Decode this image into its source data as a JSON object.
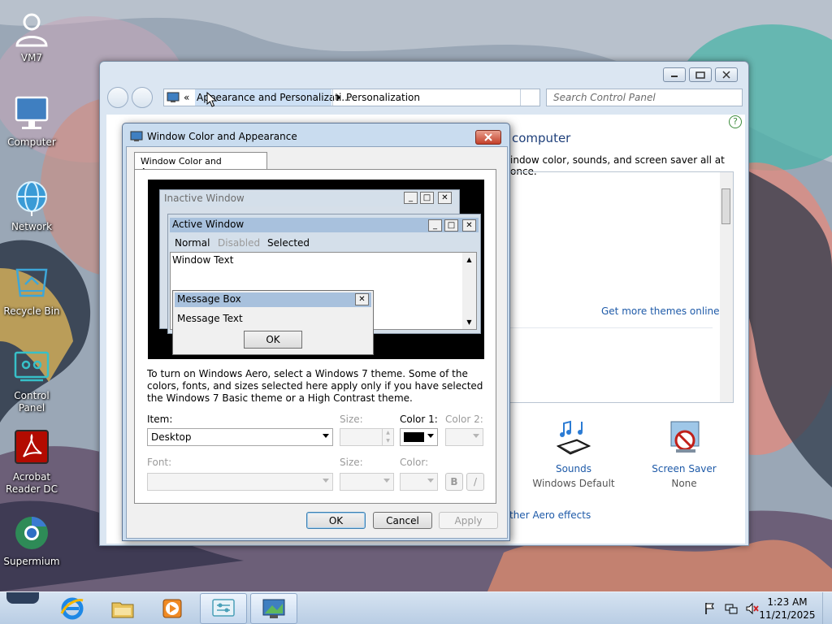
{
  "desktop": {
    "icons": [
      {
        "label": "VM7",
        "icon": "user-icon"
      },
      {
        "label": "Computer",
        "icon": "computer-icon"
      },
      {
        "label": "Network",
        "icon": "network-globe-icon"
      },
      {
        "label": "Recycle Bin",
        "icon": "recycle-bin-icon"
      },
      {
        "label": "Control Panel",
        "icon": "control-panel-icon"
      },
      {
        "label": "Acrobat Reader DC",
        "line1": "Acrobat",
        "line2": "Reader DC",
        "icon": "acrobat-icon"
      },
      {
        "label": "Supermium",
        "icon": "supermium-browser-icon"
      }
    ]
  },
  "control_panel": {
    "breadcrumb": {
      "overflow": "«",
      "parent": "Appearance and Personalizati...",
      "current": "Personalization"
    },
    "search_placeholder": "Search Control Panel",
    "heading_partial": "computer",
    "description_partial": "indow color, sounds, and screen saver all at once.",
    "get_more_themes": "Get more themes online",
    "sounds": {
      "label": "Sounds",
      "value": "Windows Default"
    },
    "screen_saver": {
      "label": "Screen Saver",
      "value": "None"
    },
    "aero_link_partial": "ther Aero effects",
    "help_glyph": "?"
  },
  "dialog": {
    "title": "Window Color and Appearance",
    "tab": "Window Color and Appearance",
    "preview": {
      "inactive_title": "Inactive Window",
      "active_title": "Active Window",
      "menu_normal": "Normal",
      "menu_disabled": "Disabled",
      "menu_selected": "Selected",
      "window_text": "Window Text",
      "message_box_title": "Message Box",
      "message_text": "Message Text",
      "ok": "OK"
    },
    "info_text": "To turn on Windows Aero, select a Windows 7 theme.  Some of the colors, fonts, and sizes selected here apply only if you have selected the Windows 7 Basic theme or a High Contrast theme.",
    "labels": {
      "item": "Item:",
      "size": "Size:",
      "color1": "Color 1:",
      "color2": "Color 2:",
      "font": "Font:",
      "font_size": "Size:",
      "color": "Color:"
    },
    "item_value": "Desktop",
    "color1_value": "#000000",
    "bold": "B",
    "italic": "/",
    "buttons": {
      "ok": "OK",
      "cancel": "Cancel",
      "apply": "Apply"
    }
  },
  "taskbar": {
    "time": "1:23 AM",
    "date": "11/21/2025",
    "apps": [
      "internet-explorer-icon",
      "file-explorer-icon",
      "media-player-icon",
      "control-panel-icon",
      "personalization-icon"
    ]
  }
}
